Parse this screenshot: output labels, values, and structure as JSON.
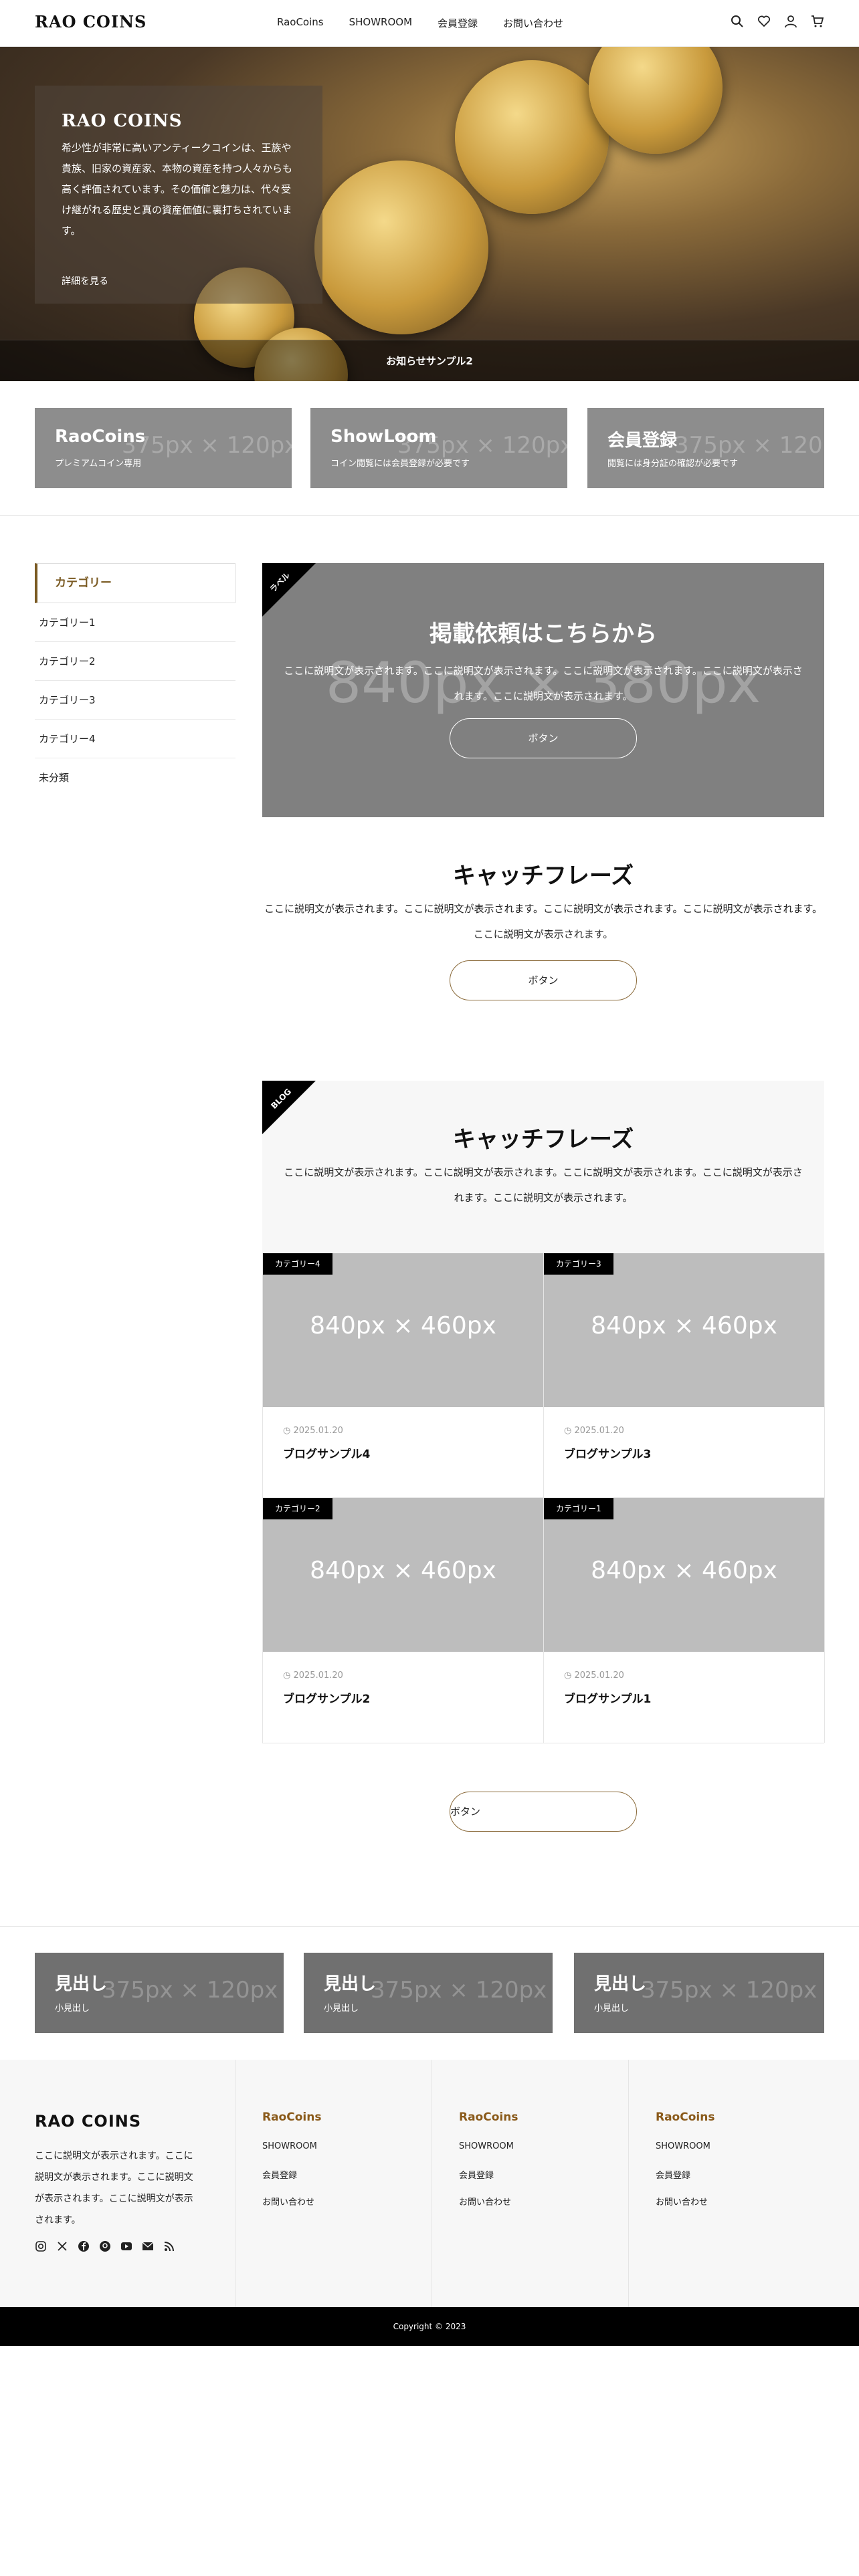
{
  "header": {
    "logo": "RAO COINS",
    "nav": [
      "RaoCoins",
      "SHOWROOM",
      "会員登録",
      "お問い合わせ"
    ],
    "icons": [
      "search-icon",
      "heart-icon",
      "user-icon",
      "cart-icon"
    ]
  },
  "hero": {
    "title": "RAO COINS",
    "text": "希少性が非常に高いアンティークコインは、王族や貴族、旧家の資産家、本物の資産を持つ人々からも高く評価されています。その価値と魅力は、代々受け継がれる歴史と真の資産価値に裏打ちされています。",
    "link": "詳細を見る",
    "news": "お知らせサンプル2"
  },
  "banners": [
    {
      "title": "RaoCoins",
      "sub": "プレミアムコイン専用",
      "placeholder": "375px × 120px"
    },
    {
      "title": "ShowLoom",
      "sub": "コイン閲覧には会員登録が必要です",
      "placeholder": "375px × 120px"
    },
    {
      "title": "会員登録",
      "sub": "閲覧には身分証の確認が必要です",
      "placeholder": "375px × 120px"
    }
  ],
  "sidebar": {
    "heading": "カテゴリー",
    "items": [
      "カテゴリー1",
      "カテゴリー2",
      "カテゴリー3",
      "カテゴリー4",
      "未分類"
    ]
  },
  "ad": {
    "ribbon": "ラベル",
    "placeholder": "840px × 380px",
    "title": "掲載依頼はこちらから",
    "desc": "ここに説明文が表示されます。ここに説明文が表示されます。ここに説明文が表示されます。ここに説明文が表示されます。ここに説明文が表示されます。",
    "button": "ボタン"
  },
  "catch": {
    "title": "キャッチフレーズ",
    "desc": "ここに説明文が表示されます。ここに説明文が表示されます。ここに説明文が表示されます。ここに説明文が表示されます。ここに説明文が表示されます。",
    "button": "ボタン"
  },
  "blog": {
    "ribbon": "BLOG",
    "title": "キャッチフレーズ",
    "desc": "ここに説明文が表示されます。ここに説明文が表示されます。ここに説明文が表示されます。ここに説明文が表示されます。ここに説明文が表示されます。",
    "button": "ボタン",
    "posts": [
      {
        "tag": "カテゴリー4",
        "placeholder": "840px × 460px",
        "date": "2025.01.20",
        "title": "ブログサンプル4"
      },
      {
        "tag": "カテゴリー3",
        "placeholder": "840px × 460px",
        "date": "2025.01.20",
        "title": "ブログサンプル3"
      },
      {
        "tag": "カテゴリー2",
        "placeholder": "840px × 460px",
        "date": "2025.01.20",
        "title": "ブログサンプル2"
      },
      {
        "tag": "カテゴリー1",
        "placeholder": "840px × 460px",
        "date": "2025.01.20",
        "title": "ブログサンプル1"
      }
    ]
  },
  "bottom_banners": [
    {
      "title": "見出し",
      "sub": "小見出し",
      "placeholder": "375px × 120px"
    },
    {
      "title": "見出し",
      "sub": "小見出し",
      "placeholder": "375px × 120px"
    },
    {
      "title": "見出し",
      "sub": "小見出し",
      "placeholder": "375px × 120px"
    }
  ],
  "footer": {
    "brand": "RAO COINS",
    "text": "ここに説明文が表示されます。ここに説明文が表示されます。ここに説明文が表示されます。ここに説明文が表示されます。",
    "social": [
      "instagram-icon",
      "x-icon",
      "facebook-icon",
      "pinterest-icon",
      "youtube-icon",
      "mail-icon",
      "rss-icon"
    ],
    "columns": [
      {
        "heading": "RaoCoins",
        "items": [
          "SHOWROOM",
          "会員登録",
          "お問い合わせ"
        ]
      },
      {
        "heading": "RaoCoins",
        "items": [
          "SHOWROOM",
          "会員登録",
          "お問い合わせ"
        ]
      },
      {
        "heading": "RaoCoins",
        "items": [
          "SHOWROOM",
          "会員登録",
          "お問い合わせ"
        ]
      }
    ],
    "copyright": "Copyright © 2023"
  },
  "colors": {
    "accent": "#8a5a1a",
    "banner": "#8d8d8d",
    "footer_bg": "#f7f7f7"
  }
}
